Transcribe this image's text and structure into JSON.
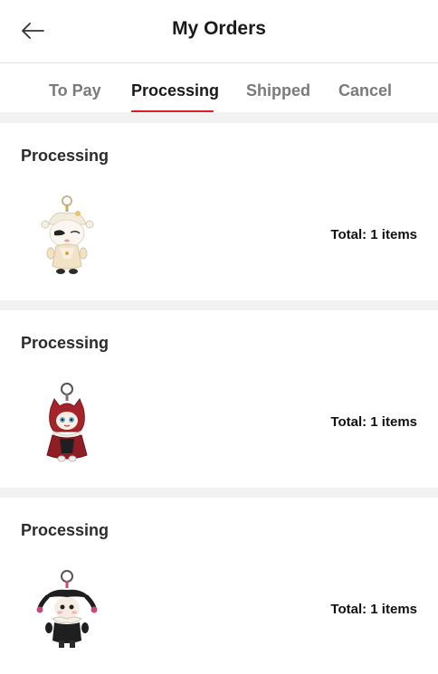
{
  "header": {
    "title": "My Orders",
    "back_icon": "arrow-left-icon"
  },
  "tabs": [
    {
      "label": "To Pay",
      "active": false
    },
    {
      "label": "Processing",
      "active": true
    },
    {
      "label": "Shipped",
      "active": false
    },
    {
      "label": "Cancel",
      "active": false
    }
  ],
  "colors": {
    "accent": "#d81e2c",
    "background_gap": "#f2f2f2"
  },
  "orders": [
    {
      "status": "Processing",
      "total": "Total: 1 items",
      "thumbnail": "jester-figure-white-keychain"
    },
    {
      "status": "Processing",
      "total": "Total: 1 items",
      "thumbnail": "red-hood-figure-keychain"
    },
    {
      "status": "Processing",
      "total": "Total: 1 items",
      "thumbnail": "jester-figure-black-keychain"
    }
  ]
}
